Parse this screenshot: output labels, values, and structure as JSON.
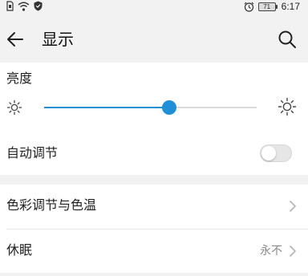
{
  "status_bar": {
    "battery": "71",
    "time": "6:17"
  },
  "header": {
    "title": "显示"
  },
  "brightness": {
    "label": "亮度",
    "level": 0.59,
    "accent": "#1f8fd8"
  },
  "auto_adjust": {
    "label": "自动调节",
    "enabled": false
  },
  "settings": {
    "color_temp_label": "色彩调节与色温",
    "sleep_label": "休眠",
    "sleep_value": "永不"
  },
  "icons": [
    "sim-icon",
    "wifi-icon",
    "shield-icon",
    "alarm-icon",
    "battery-icon",
    "back-arrow-icon",
    "search-icon",
    "sun-small-icon",
    "sun-large-icon",
    "chevron-right-icon"
  ]
}
